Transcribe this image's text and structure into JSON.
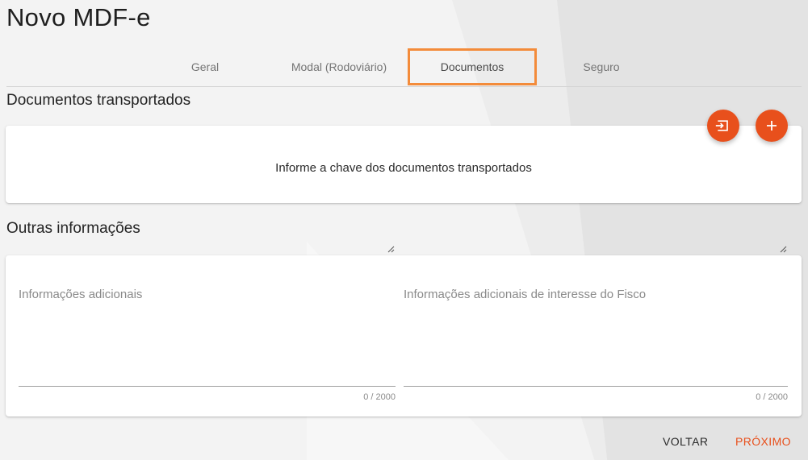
{
  "page": {
    "title": "Novo MDF-e"
  },
  "tabs": [
    {
      "label": "Geral"
    },
    {
      "label": "Modal (Rodoviário)"
    },
    {
      "label": "Documentos"
    },
    {
      "label": "Seguro"
    }
  ],
  "documents": {
    "title": "Documentos transportados",
    "hint": "Informe a chave dos documentos transportados",
    "import_icon": "import-icon",
    "add_icon": "plus-icon"
  },
  "other_info": {
    "title": "Outras informações",
    "additional": {
      "label": "Informações adicionais",
      "value": "",
      "counter": "0 / 2000"
    },
    "fisco": {
      "label": "Informações adicionais de interesse do Fisco",
      "value": "",
      "counter": "0 / 2000"
    }
  },
  "footer": {
    "back_label": "VOLTAR",
    "next_label": "PRÓXIMO"
  },
  "colors": {
    "accent": "#e8501c",
    "highlight": "#f38b3a"
  }
}
